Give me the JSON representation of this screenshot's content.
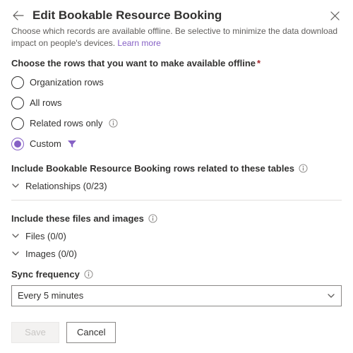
{
  "header": {
    "title": "Edit Bookable Resource Booking",
    "description_prefix": "Choose which records are available offline. Be selective to minimize the data download impact on people's devices. ",
    "learn_more": "Learn more"
  },
  "rows_section": {
    "label": "Choose the rows that you want to make available offline",
    "options": {
      "org": "Organization rows",
      "all": "All rows",
      "related": "Related rows only",
      "custom": "Custom"
    },
    "selected": "custom"
  },
  "related_tables": {
    "label": "Include Bookable Resource Booking rows related to these tables",
    "relationships_label": "Relationships (0/23)"
  },
  "files_section": {
    "label": "Include these files and images",
    "files": "Files (0/0)",
    "images": "Images (0/0)"
  },
  "sync": {
    "label": "Sync frequency",
    "value": "Every 5 minutes"
  },
  "footer": {
    "save": "Save",
    "cancel": "Cancel"
  },
  "icons": {
    "back": "back-arrow",
    "close": "close-x",
    "info": "info-circle",
    "filter": "filter-funnel",
    "chevron_down": "chevron-down"
  }
}
